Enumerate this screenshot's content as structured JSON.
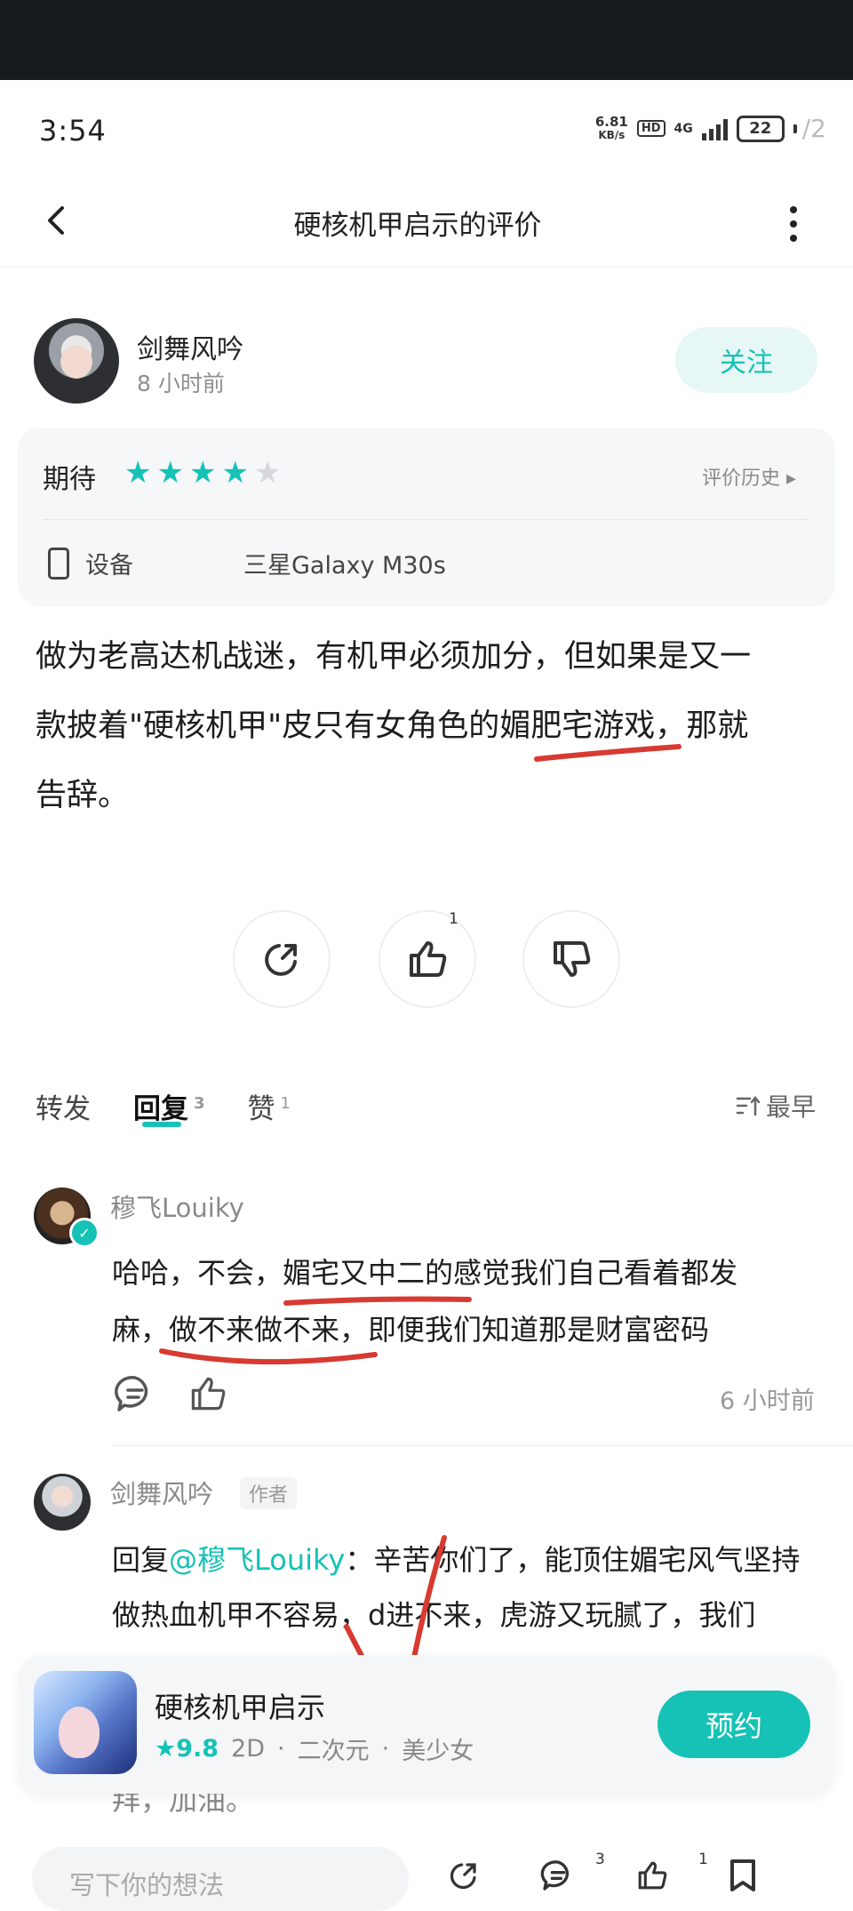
{
  "status_bar": {
    "time": "3:54",
    "net_speed": "6.81",
    "net_unit": "KB/s",
    "hd": "HD",
    "network": "4G",
    "battery": "22",
    "battery_extra": "/2"
  },
  "nav": {
    "title": "硬核机甲启示的评价"
  },
  "author": {
    "name": "剑舞风吟",
    "time": "8 小时前",
    "follow_label": "关注"
  },
  "rating": {
    "label": "期待",
    "stars": 4,
    "max_stars": 5,
    "history_label": "评价历史 ▸",
    "device_label": "设备",
    "device_value": "三星Galaxy M30s"
  },
  "review": {
    "line1": "做为老高达机战迷，有机甲必须加分，但如果是又一",
    "line2": "款披着\"硬核机甲\"皮只有女角色的媚肥宅游戏，那就",
    "line3": "告辞。"
  },
  "actions": {
    "like_count": "1"
  },
  "tabs": [
    {
      "label": "转发",
      "count": ""
    },
    {
      "label": "回复",
      "count": "3"
    },
    {
      "label": "赞",
      "count": "1"
    }
  ],
  "sort_label": "最早",
  "comments": [
    {
      "name": "穆飞Louiky",
      "line1": "哈哈，不会，媚宅又中二的感觉我们自己看着都发",
      "line2": "麻，做不来做不来，即便我们知道那是财富密码",
      "time": "6 小时前"
    },
    {
      "name": "剑舞风吟",
      "badge": "作者",
      "reply_prefix": "回复",
      "mention": "@穆飞Louiky",
      "line1_rest": "：辛苦你们了，能顶住媚宅风气坚持",
      "line2": "做热血机甲不容易，d进不来，虎游又玩腻了，我们",
      "tail": "拜，加油。"
    }
  ],
  "game_card": {
    "name": "硬核机甲启示",
    "score": "★9.8",
    "tag1": "2D",
    "tag2": "二次元",
    "tag3": "美少女",
    "separator": "·",
    "reserve_label": "预约"
  },
  "bottom_bar": {
    "input_placeholder": "写下你的想法",
    "comment_count": "3",
    "like_count": "1"
  },
  "colors": {
    "accent": "#15c2b5",
    "annotation_red": "#d73a31"
  }
}
